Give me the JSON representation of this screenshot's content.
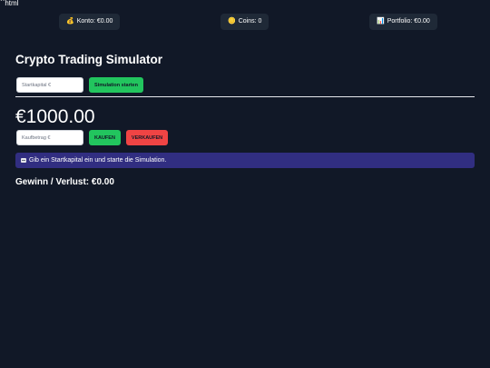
{
  "stray_text": "``html",
  "stats": {
    "konto": {
      "icon": "💰",
      "icon_name": "money-bag-icon",
      "label": "Konto: €0.00"
    },
    "coins": {
      "icon": "🪙",
      "icon_name": "coin-icon",
      "label": "Coins: 0"
    },
    "portfolio": {
      "icon": "📊",
      "icon_name": "bar-chart-icon",
      "label": "Portfolio: €0.00"
    }
  },
  "title": "Crypto Trading Simulator",
  "start": {
    "input_placeholder": "Startkapital €",
    "input_value": "",
    "button_label": "Simulation starten"
  },
  "balance": "€1000.00",
  "trade": {
    "input_placeholder": "Kaufbetrag €",
    "input_value": "",
    "buy_label": "KAUFEN",
    "sell_label": "VERKAUFEN"
  },
  "info": {
    "icon_name": "newspaper-icon",
    "text": "Gib ein Startkapital ein und starte die Simulation."
  },
  "pnl": "Gewinn / Verlust: €0.00",
  "colors": {
    "background": "#111827",
    "panel": "#1f2937",
    "green": "#22c55e",
    "red": "#ef4444",
    "info": "#312e81"
  }
}
